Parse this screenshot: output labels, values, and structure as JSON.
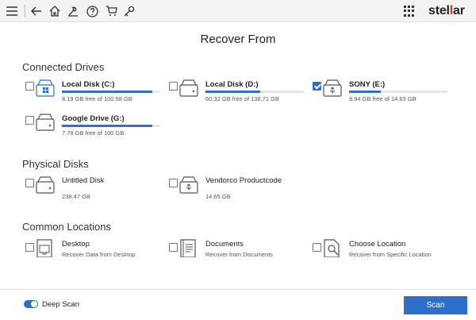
{
  "toolbar": {
    "brand_prefix": "stel",
    "brand_accent": "l",
    "brand_suffix": "ar",
    "accent_color": "#e0301e",
    "icons": [
      "menu-icon",
      "back-icon",
      "home-icon",
      "wrench-icon",
      "help-icon",
      "cart-icon",
      "key-icon",
      "apps-grid-icon"
    ]
  },
  "title": "Recover From",
  "sections": {
    "connected": "Connected Drives",
    "physical": "Physical Disks",
    "common": "Common Locations"
  },
  "connected_drives": [
    {
      "name": "Local Disk (C:)",
      "detail": "8.19 GB free of 100.58 GB",
      "used_fraction": 0.92,
      "checked": false,
      "icon": "windows-drive-icon"
    },
    {
      "name": "Local Disk (D:)",
      "detail": "60.32 GB free of 136.71 GB",
      "used_fraction": 0.56,
      "checked": false,
      "icon": "drive-icon"
    },
    {
      "name": "SONY (E:)",
      "detail": "9.94 GB free of 14.63 GB",
      "used_fraction": 0.32,
      "checked": true,
      "icon": "usb-drive-icon"
    },
    {
      "name": "Google Drive (G:)",
      "detail": "7.78 GB free of 100 GB",
      "used_fraction": 0.92,
      "checked": false,
      "icon": "drive-icon"
    }
  ],
  "physical_disks": [
    {
      "name": "Untitled Disk",
      "detail": "238.47 GB",
      "checked": false,
      "icon": "drive-icon"
    },
    {
      "name": "Vendorco Productcode",
      "detail": "14.65 GB",
      "checked": false,
      "icon": "usb-drive-icon"
    }
  ],
  "common_locations": [
    {
      "name": "Desktop",
      "detail": "Recover Data from Desktop",
      "checked": false,
      "icon": "desktop-folder-icon"
    },
    {
      "name": "Documents",
      "detail": "Recover from Documents",
      "checked": false,
      "icon": "documents-icon"
    },
    {
      "name": "Choose Location",
      "detail": "Recover from Specific Location",
      "checked": false,
      "icon": "choose-location-icon"
    }
  ],
  "footer": {
    "deep_scan_label": "Deep Scan",
    "deep_scan_on": true,
    "scan_label": "Scan"
  },
  "colors": {
    "primary": "#2d6fc9"
  }
}
